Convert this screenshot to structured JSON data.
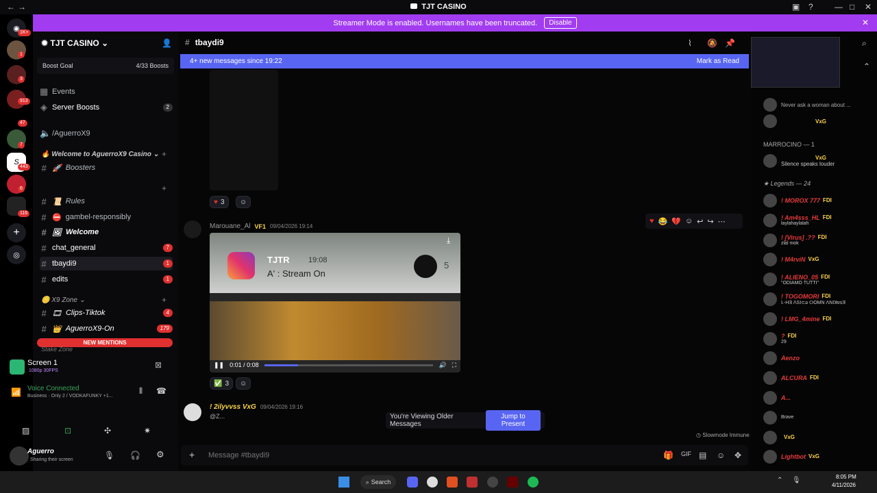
{
  "window": {
    "title": "TJT CASINO"
  },
  "streamer": {
    "text": "Streamer Mode is enabled. Usernames have been truncated.",
    "disable": "Disable"
  },
  "guild_badges": [
    "1K+",
    "1",
    "3",
    "913",
    "47",
    "7",
    "443",
    "6",
    "116"
  ],
  "server": {
    "name": "TJT CASINO",
    "boost_goal": "Boost Goal",
    "boost_count": "4/33 Boosts"
  },
  "channels": [
    {
      "label": "Events",
      "icon": "calendar-icon",
      "badge": ""
    },
    {
      "label": "Server Boosts",
      "icon": "boost-icon",
      "badge": "2"
    },
    {
      "label": "/AguerroX9",
      "icon": "speaker-icon",
      "badge": ""
    },
    {
      "label": "Boosters",
      "icon": "hash-icon",
      "badge": ""
    },
    {
      "label": "Rules",
      "icon": "hash-icon",
      "badge": ""
    },
    {
      "label": "gambel-responsibly",
      "icon": "hash-icon",
      "badge": ""
    },
    {
      "label": "Welcome",
      "icon": "hash-icon",
      "badge": ""
    },
    {
      "label": "chat_general",
      "icon": "hash-icon",
      "badge": "7"
    },
    {
      "label": "tbaydi9",
      "icon": "hash-icon",
      "badge": "1"
    },
    {
      "label": "edits",
      "icon": "hash-icon",
      "badge": "1"
    },
    {
      "label": "Clips-Tiktok",
      "icon": "hash-icon",
      "badge": "4"
    },
    {
      "label": "AguerroX9-On",
      "icon": "hash-icon",
      "badge": "179"
    }
  ],
  "categories": {
    "welcome": "Welcome to AguerroX9 Casino",
    "x9zone": "X9 Zone",
    "stakezone": "Stake Zone"
  },
  "new_mentions": "NEW MENTIONS",
  "screen": {
    "title": "Screen 1",
    "sub": "1080p 30FPS"
  },
  "voice": {
    "status": "Voice Connected",
    "detail": "Business · Only 2 / VODKAFUNKY +1..."
  },
  "user": {
    "name": "Aguerro",
    "status": "Sharing their screen"
  },
  "channel_header": {
    "name": "tbaydi9"
  },
  "new_messages": {
    "text": "4+ new messages since 19:22",
    "mark": "Mark as Read"
  },
  "reactions": {
    "first": "3",
    "second": "3"
  },
  "message1": {
    "author": "Marouane_Al",
    "tag": "VF1",
    "time": "09/04/2026 19:14"
  },
  "video": {
    "ig_name": "TJTR",
    "ig_time": "19:08",
    "ig_text": "A' : Stream On",
    "ig_count": "5",
    "time": "0:01 / 0:08"
  },
  "message2": {
    "author": "! 2ilyvvss VxG",
    "time": "09/04/2026 19:16",
    "text": "@Z..."
  },
  "older": {
    "text": "You're Viewing Older Messages",
    "jump": "Jump to Present"
  },
  "slowmode": "Slowmode Immune",
  "input": {
    "placeholder": "Message #tbaydi9"
  },
  "members": {
    "top": [
      {
        "name": "",
        "status": "Never ask a woman about ..."
      },
      {
        "name": "",
        "tag": "VxG"
      }
    ],
    "marrocino_header": "MARROCINO — 1",
    "marrocino": [
      {
        "name": "",
        "tag": "VxG",
        "status": "Silence speaks louder"
      }
    ],
    "legends_header": "Legends — 24",
    "legends": [
      {
        "name": "! MOROX 777",
        "tag": "FDI",
        "color": "#e83a3a",
        "status": ""
      },
      {
        "name": "! Am4sss_HL",
        "tag": "FDI",
        "color": "#e83a3a",
        "status": "laylahaylalah"
      },
      {
        "name": "! [Virus] .??",
        "tag": "FDI",
        "color": "#e83a3a",
        "status": "zlal mok"
      },
      {
        "name": "! M4rviN",
        "tag": "VxG",
        "color": "#e83a3a",
        "status": ""
      },
      {
        "name": "! ALIENO_05",
        "tag": "FDI",
        "color": "#e83a3a",
        "status": "\"ODIAMO TUTTI\""
      },
      {
        "name": "! TOGOMORI",
        "tag": "FDI",
        "color": "#e83a3a",
        "status": "ʇ.-ΗƎ ⴷSI⊂ǝ ⵔOMN ⴷNIꓘɐsƎ"
      },
      {
        "name": "! LMG_4mine",
        "tag": "FDI",
        "color": "#e83a3a",
        "status": ""
      },
      {
        "name": "?",
        "tag": "FDI",
        "color": "#e83a3a",
        "status": "29"
      },
      {
        "name": "Aenzo",
        "tag": "",
        "color": "#e83a3a",
        "status": ""
      },
      {
        "name": "ALCURA",
        "tag": "FDI",
        "color": "#e83a3a",
        "status": ""
      },
      {
        "name": "A...",
        "tag": "",
        "color": "#e83a3a",
        "status": ""
      },
      {
        "name": "",
        "tag": "",
        "color": "#e83a3a",
        "status": "Brave"
      },
      {
        "name": "",
        "tag": "VxG",
        "color": "#e83a3a",
        "status": ""
      },
      {
        "name": "Lightbot",
        "tag": "VxG",
        "color": "#e83a3a",
        "status": ""
      }
    ]
  },
  "taskbar": {
    "search": "Search",
    "time": "8:05 PM",
    "date": "4/11/2026"
  }
}
